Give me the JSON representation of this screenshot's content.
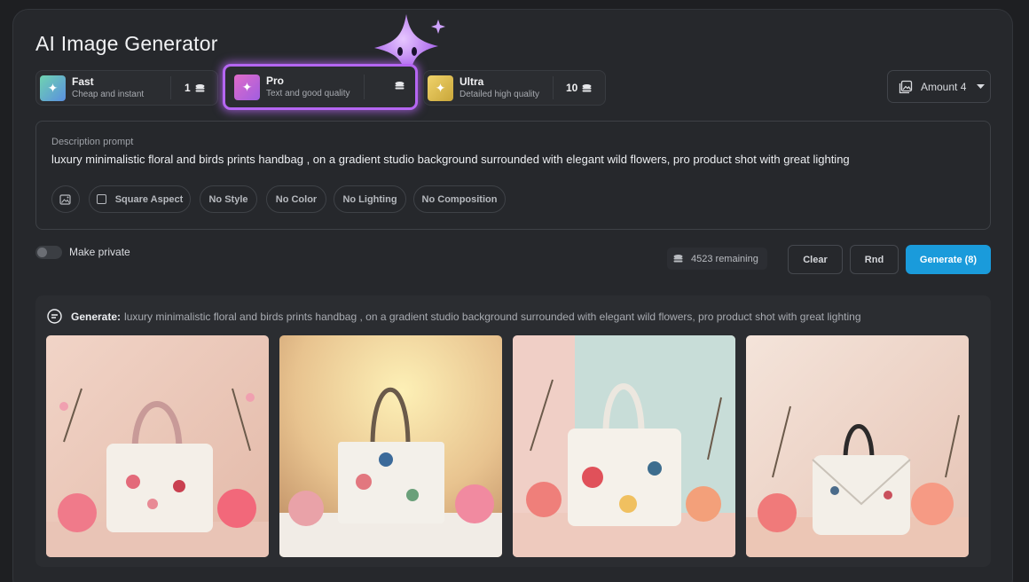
{
  "app": {
    "title": "AI Image Generator"
  },
  "tiers": [
    {
      "name": "Fast",
      "desc": "Cheap and instant",
      "cost": "1",
      "selected": false
    },
    {
      "name": "Pro",
      "desc": "Text and good quality",
      "cost": "",
      "selected": true
    },
    {
      "name": "Ultra",
      "desc": "Detailed high quality",
      "cost": "10",
      "selected": false
    }
  ],
  "amount": {
    "label": "Amount 4"
  },
  "prompt": {
    "label": "Description prompt",
    "text": "luxury minimalistic floral and birds prints handbag , on a gradient studio background surrounded with elegant wild flowers, pro product shot with great lighting"
  },
  "chips": [
    "Square Aspect",
    "No Style",
    "No Color",
    "No Lighting",
    "No Composition"
  ],
  "privacy": {
    "label": "Make private",
    "on": false
  },
  "credits": {
    "remaining": "4523 remaining"
  },
  "buttons": {
    "clear": "Clear",
    "random": "Rnd",
    "generate": "Generate (8)"
  },
  "results": {
    "label": "Generate:",
    "prompt": "luxury minimalistic floral and birds prints handbag , on a gradient studio background surrounded with elegant wild flowers, pro product shot with great lighting"
  },
  "colors": {
    "accent": "#1a9bdb",
    "selected_border": "#b566f2"
  }
}
